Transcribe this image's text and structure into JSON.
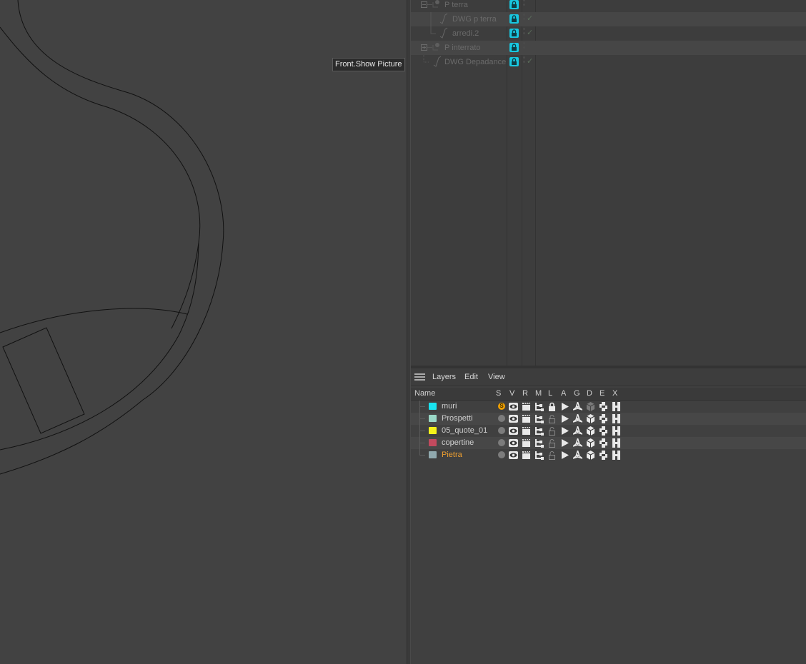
{
  "viewport": {
    "tooltip": "Front.Show Picture"
  },
  "object_manager": {
    "rows": [
      {
        "name": "P terra",
        "type": "group",
        "indent": 0,
        "check": false
      },
      {
        "name": "DWG p terra",
        "type": "spline",
        "indent": 1,
        "check": true
      },
      {
        "name": "arredi.2",
        "type": "spline",
        "indent": 1,
        "check": true
      },
      {
        "name": "P interrato",
        "type": "group",
        "indent": 0,
        "check": false
      },
      {
        "name": "DWG Depadance",
        "type": "spline",
        "indent": 0,
        "check": true
      }
    ],
    "lock_color": "#18c7e0"
  },
  "layer_manager": {
    "menu": {
      "layers": "Layers",
      "edit": "Edit",
      "view": "View"
    },
    "header": {
      "name": "Name",
      "s": "S",
      "v": "V",
      "r": "R",
      "m": "M",
      "l": "L",
      "a": "A",
      "g": "G",
      "d": "D",
      "e": "E",
      "x": "X"
    },
    "layers": [
      {
        "name": "muri",
        "color": "#19e3f0",
        "solo": true,
        "locked": true,
        "deformers_dim": true,
        "name_color": "#cfcfcf"
      },
      {
        "name": "Prospetti",
        "color": "#9ad8c7",
        "solo": false,
        "locked": false,
        "deformers_dim": false,
        "name_color": "#cfcfcf"
      },
      {
        "name": "05_quote_01",
        "color": "#f4f21a",
        "solo": false,
        "locked": false,
        "deformers_dim": false,
        "name_color": "#cfcfcf"
      },
      {
        "name": "copertine",
        "color": "#c24a5e",
        "solo": false,
        "locked": false,
        "deformers_dim": false,
        "name_color": "#cfcfcf"
      },
      {
        "name": "Pietra",
        "color": "#90a9ae",
        "solo": false,
        "locked": false,
        "deformers_dim": false,
        "name_color": "#f0a030"
      }
    ]
  }
}
